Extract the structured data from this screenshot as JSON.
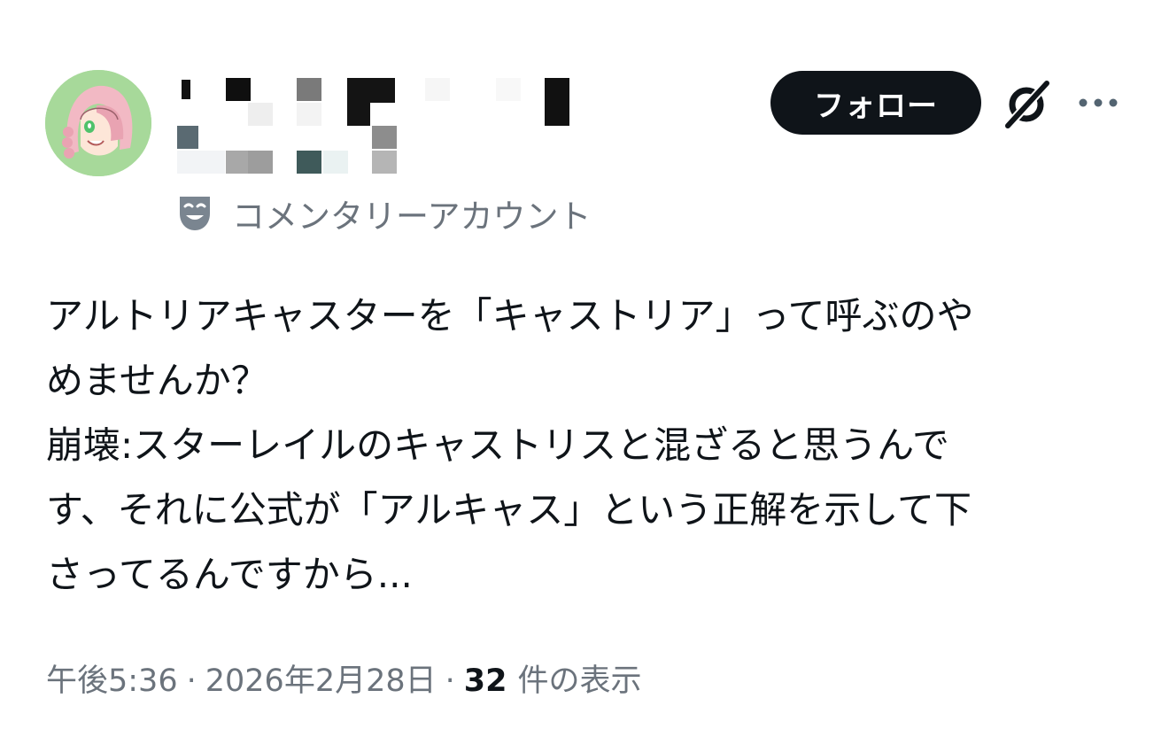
{
  "account": {
    "label": "コメンタリーアカウント"
  },
  "follow_button_label": "フォロー",
  "post": {
    "lines": [
      "アルトリアキャスターを「キャストリア」って呼ぶのや",
      "めませんか？",
      "崩壊:スターレイルのキャストリスと混ざると思うんで",
      "す、それに公式が「アルキャス」という正解を示して下",
      "さってるんですから..."
    ]
  },
  "meta": {
    "time": "午後5:36",
    "separator": "·",
    "date": "2026年2月28日",
    "views_count": "32",
    "views_label": "件の表示"
  },
  "icons": {
    "grok": "grok-icon",
    "more": "more-icon",
    "mask": "mask-icon"
  },
  "colors": {
    "follow_bg": "#0f1419",
    "secondary_text": "#6b737c",
    "avatar_bg": "#a7d99a"
  }
}
